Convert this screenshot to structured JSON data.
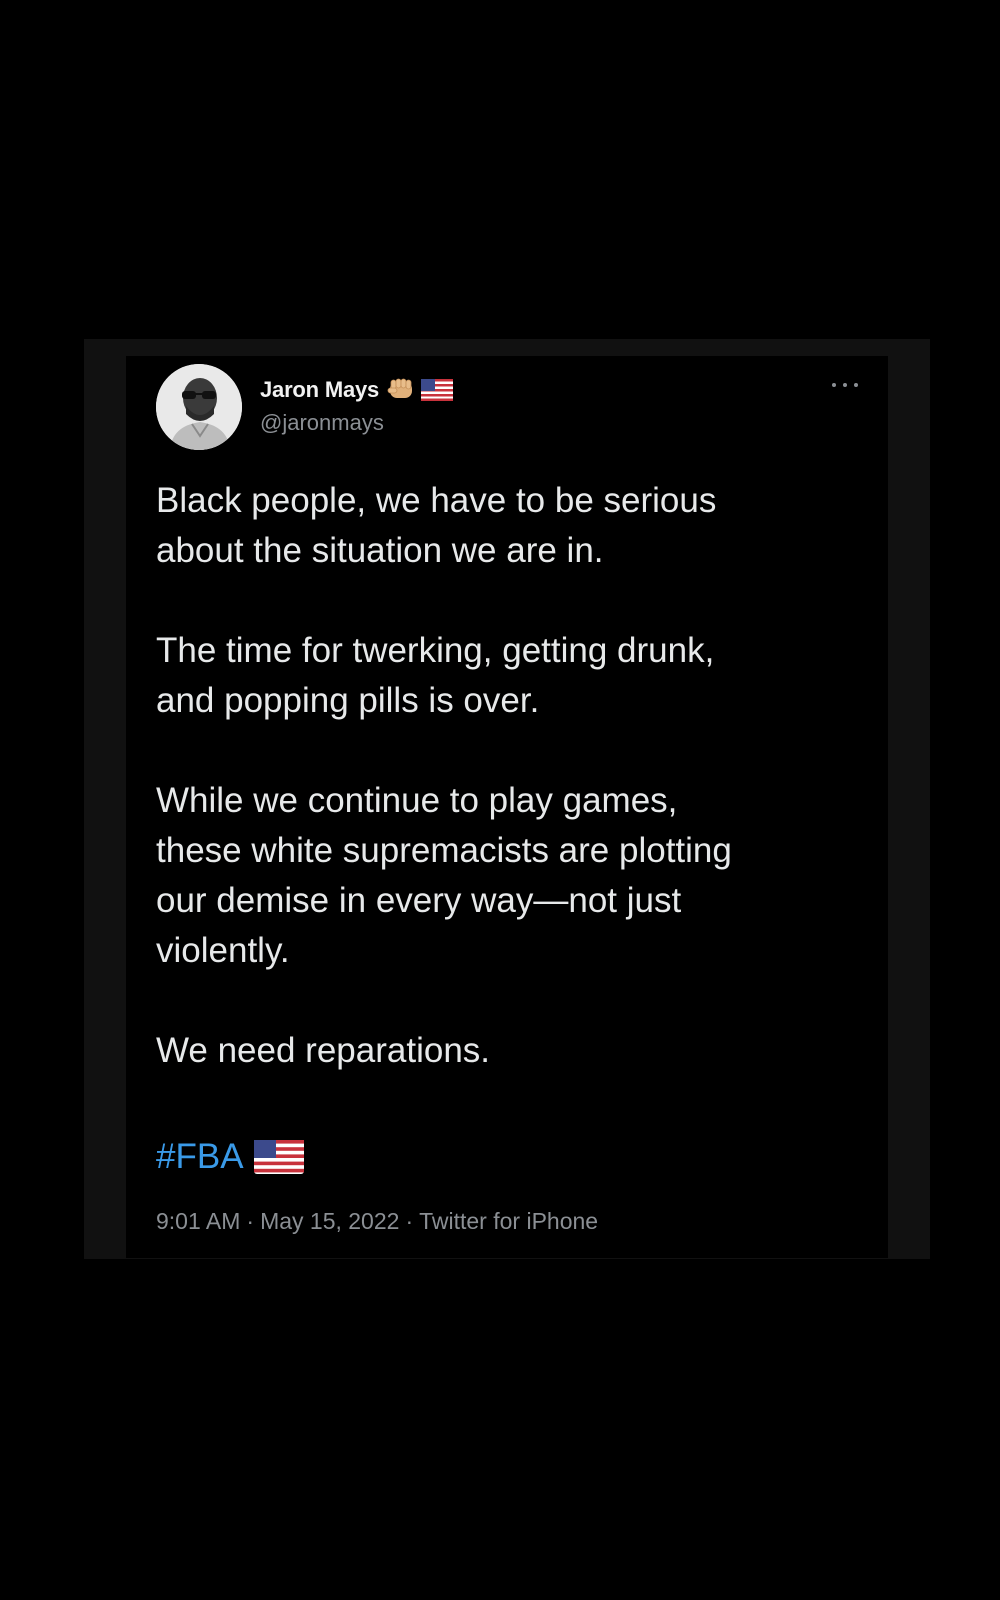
{
  "tweet": {
    "author": {
      "display_name": "Jaron Mays",
      "handle": "@jaronmays",
      "badges": [
        "raised-fist-icon",
        "us-flag-icon"
      ]
    },
    "paragraphs": [
      "Black people, we have to be serious\nabout the situation we are in.",
      "The time for twerking, getting drunk,\nand popping pills is over.",
      "While we continue to play games,\nthese white supremacists are plotting\nour demise in every way—not just\nviolently.",
      "We need reparations."
    ],
    "hashtag": "#FBA",
    "hashtag_emoji": "us-flag-icon",
    "meta": {
      "time": "9:01 AM",
      "separator": "·",
      "date": "May 15, 2022",
      "source": "Twitter for iPhone"
    }
  },
  "colors": {
    "background": "#000000",
    "text": "#e7e9ea",
    "secondary_text": "#8b8f94",
    "link": "#3a9ae8"
  }
}
